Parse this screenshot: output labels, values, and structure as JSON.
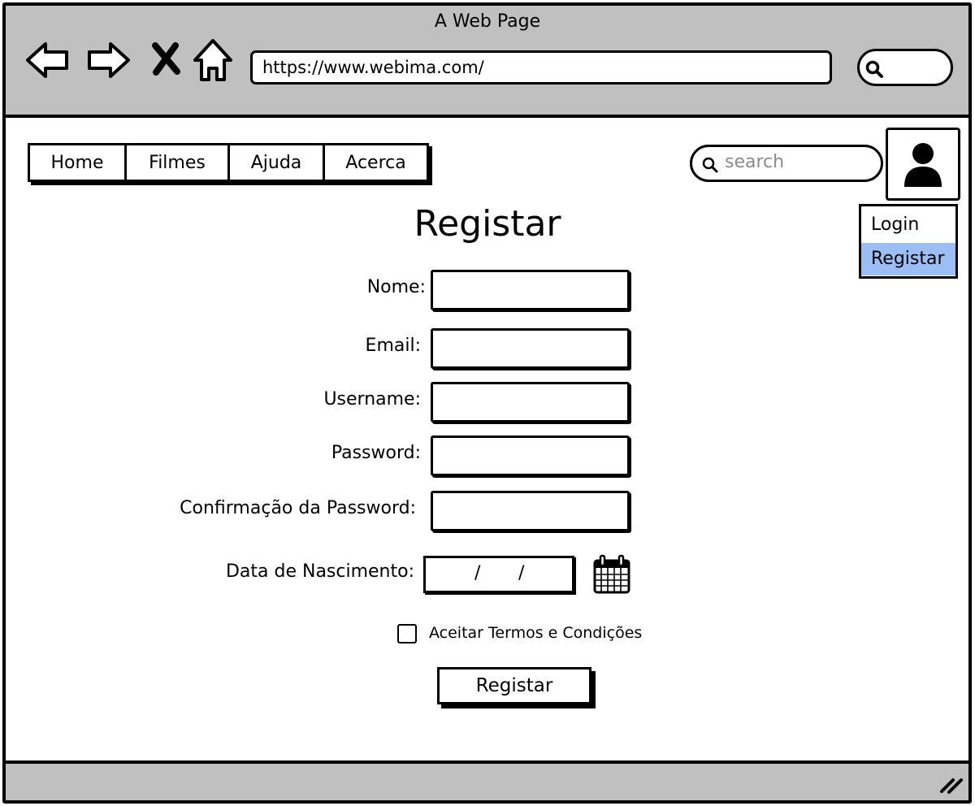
{
  "browser": {
    "window_title": "A Web Page",
    "url": "https://www.webima.com/",
    "icons": [
      "back-arrow-icon",
      "forward-arrow-icon",
      "close-x-icon",
      "home-icon",
      "search-icon",
      "resize-grip-icon"
    ]
  },
  "nav": {
    "tabs": [
      {
        "label": "Home"
      },
      {
        "label": "Filmes"
      },
      {
        "label": "Ajuda"
      },
      {
        "label": "Acerca"
      }
    ]
  },
  "search": {
    "placeholder": "search"
  },
  "user_menu": {
    "icon": "user-avatar-icon",
    "items": [
      {
        "label": "Login",
        "selected": false
      },
      {
        "label": "Registar",
        "selected": true
      }
    ],
    "selected_color": "#9bbef5"
  },
  "form": {
    "title": "Registar",
    "fields": [
      {
        "label": "Nome:",
        "value": ""
      },
      {
        "label": "Email:",
        "value": ""
      },
      {
        "label": "Username:",
        "value": ""
      },
      {
        "label": "Password:",
        "value": ""
      },
      {
        "label": "Confirmação da Password:",
        "value": ""
      }
    ],
    "birth_date": {
      "label": "Data de Nascimento:",
      "separator": "/",
      "icon": "calendar-icon"
    },
    "terms": {
      "label": "Aceitar Termos e Condições",
      "checked": false
    },
    "submit_label": "Registar"
  },
  "colors": {
    "chrome": "#c0c0c0",
    "placeholder": "#8a8a8a"
  }
}
